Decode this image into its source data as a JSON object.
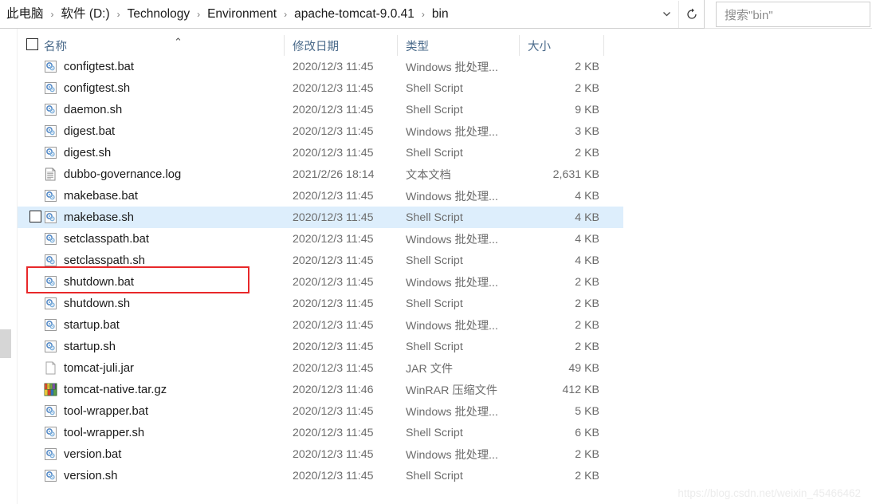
{
  "address": {
    "crumbs": [
      "此电脑",
      "软件 (D:)",
      "Technology",
      "Environment",
      "apache-tomcat-9.0.41",
      "bin"
    ],
    "separator": "›",
    "chevron_icon": "chevron-down-icon",
    "refresh_icon": "refresh-icon"
  },
  "search": {
    "placeholder": "搜索\"bin\"",
    "value": "搜索\"bin\""
  },
  "columns": {
    "name": "名称",
    "date": "修改日期",
    "type": "类型",
    "size": "大小",
    "sort_arrow": "⌃"
  },
  "files": [
    {
      "name": "configtest.bat",
      "date": "2020/12/3 11:45",
      "type": "Windows 批处理...",
      "size": "2 KB",
      "icon": "script-file-icon"
    },
    {
      "name": "configtest.sh",
      "date": "2020/12/3 11:45",
      "type": "Shell Script",
      "size": "2 KB",
      "icon": "script-file-icon"
    },
    {
      "name": "daemon.sh",
      "date": "2020/12/3 11:45",
      "type": "Shell Script",
      "size": "9 KB",
      "icon": "script-file-icon"
    },
    {
      "name": "digest.bat",
      "date": "2020/12/3 11:45",
      "type": "Windows 批处理...",
      "size": "3 KB",
      "icon": "script-file-icon"
    },
    {
      "name": "digest.sh",
      "date": "2020/12/3 11:45",
      "type": "Shell Script",
      "size": "2 KB",
      "icon": "script-file-icon"
    },
    {
      "name": "dubbo-governance.log",
      "date": "2021/2/26 18:14",
      "type": "文本文档",
      "size": "2,631 KB",
      "icon": "text-document-icon"
    },
    {
      "name": "makebase.bat",
      "date": "2020/12/3 11:45",
      "type": "Windows 批处理...",
      "size": "4 KB",
      "icon": "script-file-icon"
    },
    {
      "name": "makebase.sh",
      "date": "2020/12/3 11:45",
      "type": "Shell Script",
      "size": "4 KB",
      "icon": "script-file-icon",
      "hover": true
    },
    {
      "name": "setclasspath.bat",
      "date": "2020/12/3 11:45",
      "type": "Windows 批处理...",
      "size": "4 KB",
      "icon": "script-file-icon"
    },
    {
      "name": "setclasspath.sh",
      "date": "2020/12/3 11:45",
      "type": "Shell Script",
      "size": "4 KB",
      "icon": "script-file-icon"
    },
    {
      "name": "shutdown.bat",
      "date": "2020/12/3 11:45",
      "type": "Windows 批处理...",
      "size": "2 KB",
      "icon": "script-file-icon",
      "annotated": true
    },
    {
      "name": "shutdown.sh",
      "date": "2020/12/3 11:45",
      "type": "Shell Script",
      "size": "2 KB",
      "icon": "script-file-icon"
    },
    {
      "name": "startup.bat",
      "date": "2020/12/3 11:45",
      "type": "Windows 批处理...",
      "size": "2 KB",
      "icon": "script-file-icon"
    },
    {
      "name": "startup.sh",
      "date": "2020/12/3 11:45",
      "type": "Shell Script",
      "size": "2 KB",
      "icon": "script-file-icon"
    },
    {
      "name": "tomcat-juli.jar",
      "date": "2020/12/3 11:45",
      "type": "JAR 文件",
      "size": "49 KB",
      "icon": "blank-document-icon"
    },
    {
      "name": "tomcat-native.tar.gz",
      "date": "2020/12/3 11:46",
      "type": "WinRAR 压缩文件",
      "size": "412 KB",
      "icon": "winrar-archive-icon"
    },
    {
      "name": "tool-wrapper.bat",
      "date": "2020/12/3 11:45",
      "type": "Windows 批处理...",
      "size": "5 KB",
      "icon": "script-file-icon"
    },
    {
      "name": "tool-wrapper.sh",
      "date": "2020/12/3 11:45",
      "type": "Shell Script",
      "size": "6 KB",
      "icon": "script-file-icon"
    },
    {
      "name": "version.bat",
      "date": "2020/12/3 11:45",
      "type": "Windows 批处理...",
      "size": "2 KB",
      "icon": "script-file-icon"
    },
    {
      "name": "version.sh",
      "date": "2020/12/3 11:45",
      "type": "Shell Script",
      "size": "2 KB",
      "icon": "script-file-icon"
    }
  ],
  "annotation": {
    "color": "#e8282a",
    "target": "shutdown.bat"
  },
  "watermark": "https://blog.csdn.net/weixin_45466462",
  "colors": {
    "hover_row": "#ddeefc",
    "header_text": "#4a6a8a",
    "annotation": "#e8282a"
  }
}
